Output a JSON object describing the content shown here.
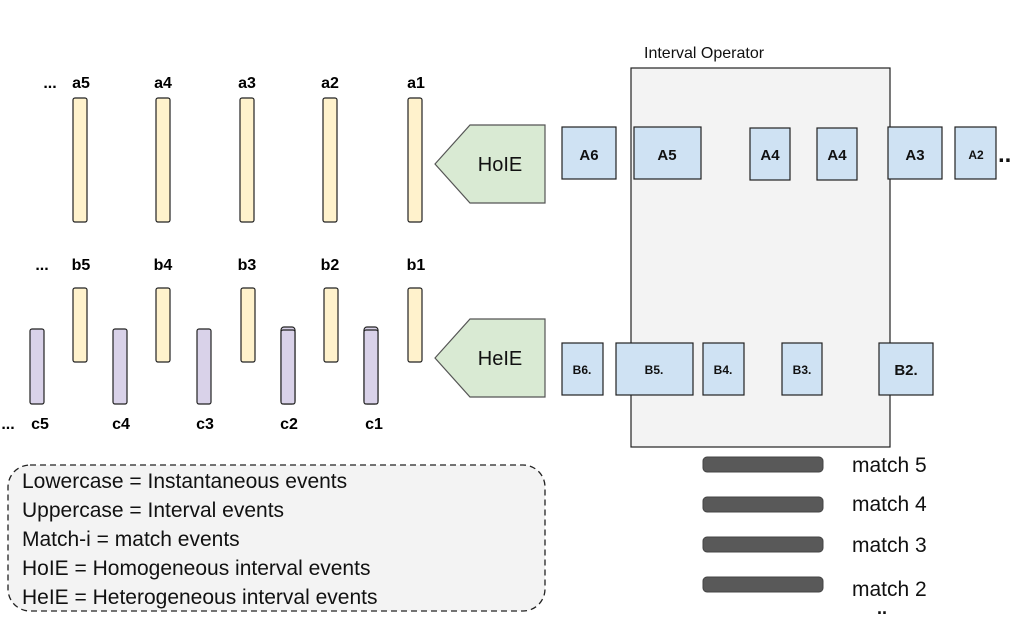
{
  "operator": {
    "title": "Interval Operator"
  },
  "streams": {
    "a": {
      "labels": [
        "a5",
        "a4",
        "a3",
        "a2",
        "a1"
      ],
      "ellipsis": "...",
      "color": "#fff2cc"
    },
    "b": {
      "labels": [
        "b5",
        "b4",
        "b3",
        "b2",
        "b1"
      ],
      "ellipsis": "...",
      "color": "#fff2cc"
    },
    "c": {
      "labels": [
        "c5",
        "c4",
        "c3",
        "c2",
        "c1"
      ],
      "ellipsis": "...",
      "color": "#d9d2e9"
    }
  },
  "converters": {
    "hoie": "HoIE",
    "heie": "HeIE",
    "color": "#d9ead3"
  },
  "interval_a": {
    "labels": [
      "A6",
      "A5",
      "A4",
      "A4",
      "A3",
      "A2"
    ],
    "ellipsis": "..",
    "color": "#cfe2f3"
  },
  "interval_b": {
    "labels": [
      "B6.",
      "B5.",
      "B4.",
      "B3.",
      "B2."
    ]
  },
  "matches": {
    "labels": [
      "match 5",
      "match 4",
      "match 3",
      "match 2"
    ],
    "ellipsis": "..",
    "color": "#595959"
  },
  "legend": {
    "lines": [
      "Lowercase = Instantaneous events",
      "Uppercase = Interval events",
      "Match-i = match events",
      "HoIE = Homogeneous interval events",
      "HeIE = Heterogeneous interval events"
    ]
  }
}
